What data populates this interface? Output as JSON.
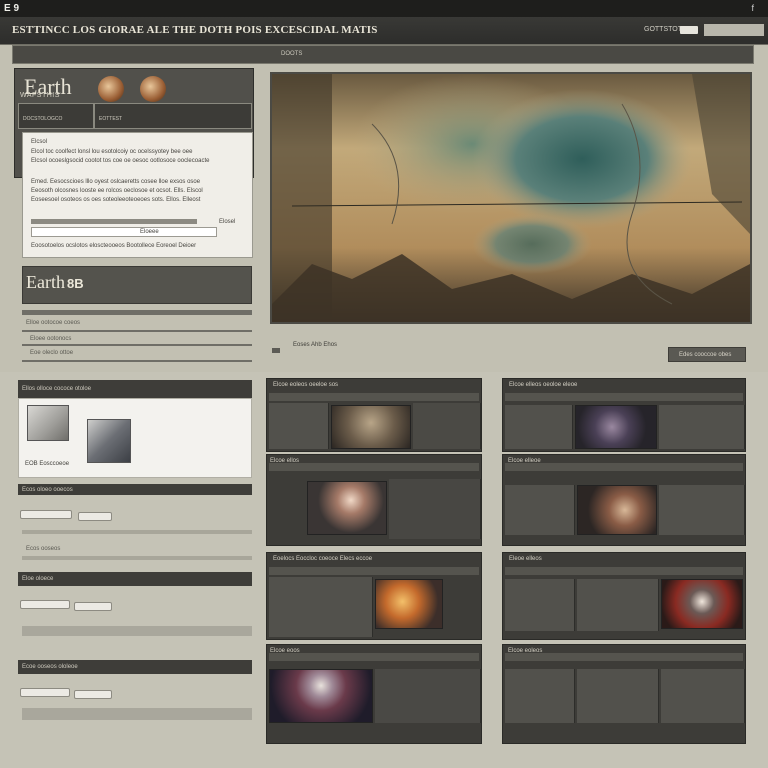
{
  "app": {
    "title": "E 9",
    "close_glyph": "f"
  },
  "header": {
    "title": "ESTTINCC LOS GIORAE ALE THE DOTH POIS EXCESCIDAL MATIS",
    "right_label": "GOTTSTOTT"
  },
  "subbar": {
    "label": "DOOTS"
  },
  "brand": {
    "logo": "Earth",
    "subtitle": "WAFSTHIS"
  },
  "tabs": [
    "DOCSTOLOGCO",
    "EOTTEST"
  ],
  "popup": {
    "heading": "Elcsol",
    "lines": [
      "Elcol toc coolfect lonsl lou esotolcoiy oc ocelssyotey bee oee",
      "Elcsol ocoeslgsocid cootot tos coe oe oesoc ootlosoce ooclecoacte",
      "Emed. Eesocscioes lllo oyest oslcaeretts cosee lloe exsos osoe",
      "Eeosoth olcosnes looste ee rolcos oeclosoe et ocsot. Ells. Elscol",
      "Eoseesoel osoteos os oes soteoleeoteoeoes sots. Ellos. Elleost"
    ],
    "field_label": "Elosel",
    "field_value": "Eloeee",
    "footer": "Eoosotoelos ocslotos eloscteooeos Bootollece Eoreoel Deioer"
  },
  "brand2": {
    "logo": "Earth",
    "glyph": "8B"
  },
  "left_lines": [
    "Elloe ootocoe coeos",
    "Eloee ootonocs",
    "Eoe oleclo ottoe"
  ],
  "map": {
    "caption": "Eoses Ahb Ehos",
    "button": "Edes cooccoe obes"
  },
  "lower_left": {
    "bar1": "Ellos olloce cococe otoloe",
    "card_caption": "EOB Eosccoeoe",
    "bar2": "Ecos oloeo ooecos",
    "row_label": "Ecos ooseos",
    "bar3": "Eloe oloece",
    "bar4": "Ecoe ooseos ololeoe"
  },
  "windows": {
    "w1": "Elcoe eoleos oeeloe sos",
    "w2": "Elcoe ellos",
    "w3": "Elcoe eoos",
    "w4": "Elcoe elleoe",
    "w5": "Eoelocs Eoccloc coeoce Elecs eccoe",
    "w6": "Elcoe elleos oeoloe eleoe",
    "w7": "Eleoe elleos",
    "w8": "Elcoe eoleos"
  }
}
